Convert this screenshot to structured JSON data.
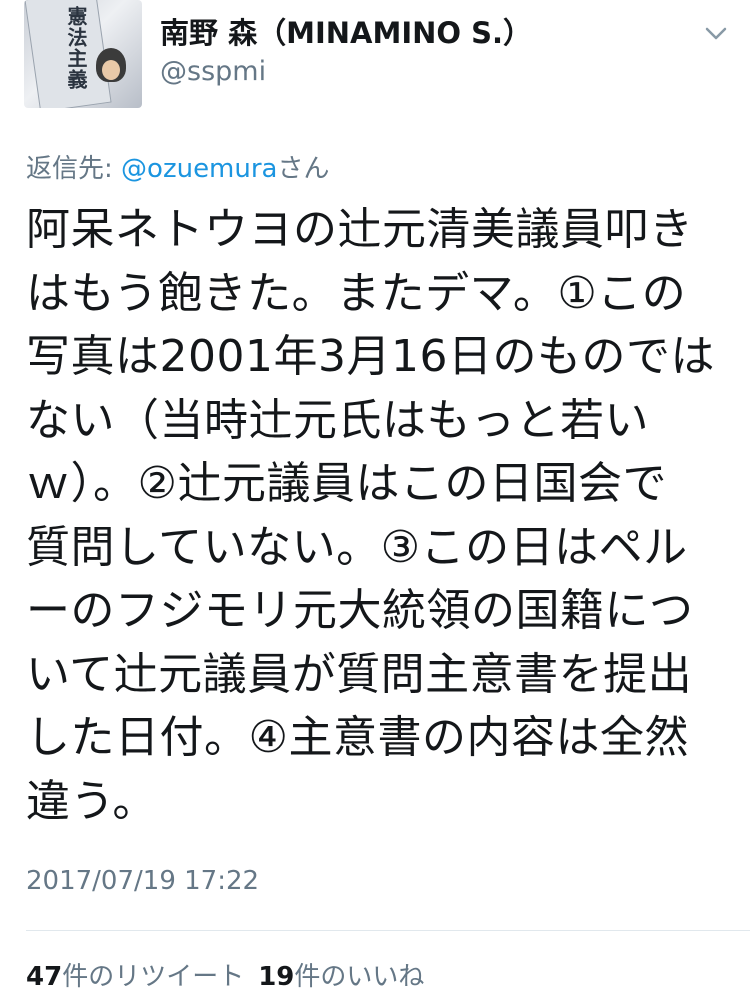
{
  "tweet": {
    "display_name": "南野 森（MINAMINO S.）",
    "username": "@sspmi",
    "reply_prefix": "返信先: ",
    "reply_handle": "@ozuemura",
    "reply_suffix": "さん",
    "body_lines": [
      "阿呆ネトウヨの辻元清美議員叩き",
      "はもう飽きた。またデマ。①この",
      "写真は2001年3月16日のものでは",
      "ない（当時辻元氏はもっと若い",
      "ｗ）。②辻元議員はこの日国会で",
      "質問していない。③この日はペル",
      "ーのフジモリ元大統領の国籍につ",
      "いて辻元議員が質問主意書を提出",
      "した日付。④主意書の内容は全然",
      "違う。"
    ],
    "timestamp": "2017/07/19 17:22",
    "retweets_count": "47",
    "retweets_label": "件のリツイート",
    "likes_count": "19",
    "likes_label": "件のいいね",
    "avatar_book_title": "憲法主義"
  },
  "icons": {
    "menu": "chevron-down-icon"
  }
}
